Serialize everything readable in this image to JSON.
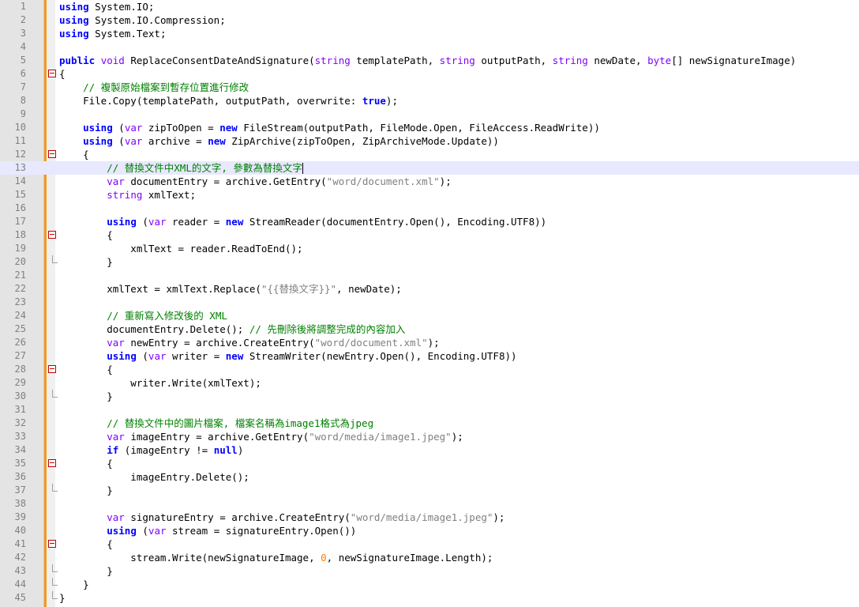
{
  "editor": {
    "current_line": 13,
    "colors": {
      "keyword": "#0000ff",
      "type": "#8000ff",
      "comment": "#008000",
      "string": "#808080",
      "number": "#ff8000",
      "current_line_bg": "#e8e8ff",
      "change_bar": "#f39a1e"
    },
    "lines": [
      {
        "n": "1",
        "fold": "",
        "tokens": [
          [
            "kw",
            "using"
          ],
          [
            "",
            "System.IO;"
          ]
        ]
      },
      {
        "n": "2",
        "fold": "",
        "tokens": [
          [
            "kw",
            "using"
          ],
          [
            "",
            "System.IO.Compression;"
          ]
        ]
      },
      {
        "n": "3",
        "fold": "",
        "tokens": [
          [
            "kw",
            "using"
          ],
          [
            "",
            "System.Text;"
          ]
        ]
      },
      {
        "n": "4",
        "fold": "",
        "tokens": []
      },
      {
        "n": "5",
        "fold": "",
        "tokens": [
          [
            "kw",
            "public"
          ],
          [
            "ty",
            "void"
          ],
          [
            "",
            " ReplaceConsentDateAndSignature("
          ],
          [
            "ty",
            "string"
          ],
          [
            "",
            " templatePath, "
          ],
          [
            "ty",
            "string"
          ],
          [
            "",
            " outputPath, "
          ],
          [
            "ty",
            "string"
          ],
          [
            "",
            " newDate, "
          ],
          [
            "ty",
            "byte"
          ],
          [
            "",
            "[] newSignatureImage)"
          ]
        ]
      },
      {
        "n": "6",
        "fold": "open",
        "tokens": [
          [
            "",
            "{"
          ]
        ]
      },
      {
        "n": "7",
        "fold": "",
        "tokens": [
          [
            "cm",
            "    // 複製原始檔案到暫存位置進行修改"
          ]
        ]
      },
      {
        "n": "8",
        "fold": "",
        "tokens": [
          [
            "",
            "    File.Copy(templatePath, outputPath, overwrite: "
          ],
          [
            "kw",
            "true"
          ],
          [
            "",
            ");"
          ]
        ]
      },
      {
        "n": "9",
        "fold": "",
        "tokens": []
      },
      {
        "n": "10",
        "fold": "",
        "tokens": [
          [
            "",
            "    "
          ],
          [
            "kw",
            "using"
          ],
          [
            "",
            " ("
          ],
          [
            "ty",
            "var"
          ],
          [
            "",
            " zipToOpen = "
          ],
          [
            "kw",
            "new"
          ],
          [
            "",
            " FileStream(outputPath, FileMode.Open, FileAccess.ReadWrite))"
          ]
        ]
      },
      {
        "n": "11",
        "fold": "",
        "tokens": [
          [
            "",
            "    "
          ],
          [
            "kw",
            "using"
          ],
          [
            "",
            " ("
          ],
          [
            "ty",
            "var"
          ],
          [
            "",
            " archive = "
          ],
          [
            "kw",
            "new"
          ],
          [
            "",
            " ZipArchive(zipToOpen, ZipArchiveMode.Update))"
          ]
        ]
      },
      {
        "n": "12",
        "fold": "open",
        "tokens": [
          [
            "",
            "    {"
          ]
        ]
      },
      {
        "n": "13",
        "fold": "",
        "tokens": [
          [
            "cm",
            "        // 替換文件中XML的文字, 參數為替換文字"
          ]
        ]
      },
      {
        "n": "14",
        "fold": "",
        "tokens": [
          [
            "",
            "        "
          ],
          [
            "ty",
            "var"
          ],
          [
            "",
            " documentEntry = archive.GetEntry("
          ],
          [
            "st",
            "\"word/document.xml\""
          ],
          [
            "",
            ");"
          ]
        ]
      },
      {
        "n": "15",
        "fold": "",
        "tokens": [
          [
            "",
            "        "
          ],
          [
            "ty",
            "string"
          ],
          [
            "",
            " xmlText;"
          ]
        ]
      },
      {
        "n": "16",
        "fold": "",
        "tokens": []
      },
      {
        "n": "17",
        "fold": "",
        "tokens": [
          [
            "",
            "        "
          ],
          [
            "kw",
            "using"
          ],
          [
            "",
            " ("
          ],
          [
            "ty",
            "var"
          ],
          [
            "",
            " reader = "
          ],
          [
            "kw",
            "new"
          ],
          [
            "",
            " StreamReader(documentEntry.Open(), Encoding.UTF8))"
          ]
        ]
      },
      {
        "n": "18",
        "fold": "open",
        "tokens": [
          [
            "",
            "        {"
          ]
        ]
      },
      {
        "n": "19",
        "fold": "",
        "tokens": [
          [
            "",
            "            xmlText = reader.ReadToEnd();"
          ]
        ]
      },
      {
        "n": "20",
        "fold": "end",
        "tokens": [
          [
            "",
            "        }"
          ]
        ]
      },
      {
        "n": "21",
        "fold": "",
        "tokens": []
      },
      {
        "n": "22",
        "fold": "",
        "tokens": [
          [
            "",
            "        xmlText = xmlText.Replace("
          ],
          [
            "st",
            "\"{{替換文字}}\""
          ],
          [
            "",
            ", newDate);"
          ]
        ]
      },
      {
        "n": "23",
        "fold": "",
        "tokens": []
      },
      {
        "n": "24",
        "fold": "",
        "tokens": [
          [
            "cm",
            "        // 重新寫入修改後的 XML"
          ]
        ]
      },
      {
        "n": "25",
        "fold": "",
        "tokens": [
          [
            "",
            "        documentEntry.Delete(); "
          ],
          [
            "cm",
            "// 先刪除後將調整完成的內容加入"
          ]
        ]
      },
      {
        "n": "26",
        "fold": "",
        "tokens": [
          [
            "",
            "        "
          ],
          [
            "ty",
            "var"
          ],
          [
            "",
            " newEntry = archive.CreateEntry("
          ],
          [
            "st",
            "\"word/document.xml\""
          ],
          [
            "",
            ");"
          ]
        ]
      },
      {
        "n": "27",
        "fold": "",
        "tokens": [
          [
            "",
            "        "
          ],
          [
            "kw",
            "using"
          ],
          [
            "",
            " ("
          ],
          [
            "ty",
            "var"
          ],
          [
            "",
            " writer = "
          ],
          [
            "kw",
            "new"
          ],
          [
            "",
            " StreamWriter(newEntry.Open(), Encoding.UTF8))"
          ]
        ]
      },
      {
        "n": "28",
        "fold": "open",
        "tokens": [
          [
            "",
            "        {"
          ]
        ]
      },
      {
        "n": "29",
        "fold": "",
        "tokens": [
          [
            "",
            "            writer.Write(xmlText);"
          ]
        ]
      },
      {
        "n": "30",
        "fold": "end",
        "tokens": [
          [
            "",
            "        }"
          ]
        ]
      },
      {
        "n": "31",
        "fold": "",
        "tokens": []
      },
      {
        "n": "32",
        "fold": "",
        "tokens": [
          [
            "cm",
            "        // 替換文件中的圖片檔案, 檔案名稱為image1格式為jpeg"
          ]
        ]
      },
      {
        "n": "33",
        "fold": "",
        "tokens": [
          [
            "",
            "        "
          ],
          [
            "ty",
            "var"
          ],
          [
            "",
            " imageEntry = archive.GetEntry("
          ],
          [
            "st",
            "\"word/media/image1.jpeg\""
          ],
          [
            "",
            ");"
          ]
        ]
      },
      {
        "n": "34",
        "fold": "",
        "tokens": [
          [
            "",
            "        "
          ],
          [
            "kw",
            "if"
          ],
          [
            "",
            " (imageEntry != "
          ],
          [
            "kw",
            "null"
          ],
          [
            "",
            ")"
          ]
        ]
      },
      {
        "n": "35",
        "fold": "open",
        "tokens": [
          [
            "",
            "        {"
          ]
        ]
      },
      {
        "n": "36",
        "fold": "",
        "tokens": [
          [
            "",
            "            imageEntry.Delete();"
          ]
        ]
      },
      {
        "n": "37",
        "fold": "end",
        "tokens": [
          [
            "",
            "        }"
          ]
        ]
      },
      {
        "n": "38",
        "fold": "",
        "tokens": []
      },
      {
        "n": "39",
        "fold": "",
        "tokens": [
          [
            "",
            "        "
          ],
          [
            "ty",
            "var"
          ],
          [
            "",
            " signatureEntry = archive.CreateEntry("
          ],
          [
            "st",
            "\"word/media/image1.jpeg\""
          ],
          [
            "",
            ");"
          ]
        ]
      },
      {
        "n": "40",
        "fold": "",
        "tokens": [
          [
            "",
            "        "
          ],
          [
            "kw",
            "using"
          ],
          [
            "",
            " ("
          ],
          [
            "ty",
            "var"
          ],
          [
            "",
            " stream = signatureEntry.Open())"
          ]
        ]
      },
      {
        "n": "41",
        "fold": "open",
        "tokens": [
          [
            "",
            "        {"
          ]
        ]
      },
      {
        "n": "42",
        "fold": "",
        "tokens": [
          [
            "",
            "            stream.Write(newSignatureImage, "
          ],
          [
            "nu",
            "0"
          ],
          [
            "",
            ", newSignatureImage.Length);"
          ]
        ]
      },
      {
        "n": "43",
        "fold": "end",
        "tokens": [
          [
            "",
            "        }"
          ]
        ]
      },
      {
        "n": "44",
        "fold": "end",
        "tokens": [
          [
            "",
            "    }"
          ]
        ]
      },
      {
        "n": "45",
        "fold": "end",
        "tokens": [
          [
            "",
            "}"
          ]
        ]
      }
    ]
  }
}
